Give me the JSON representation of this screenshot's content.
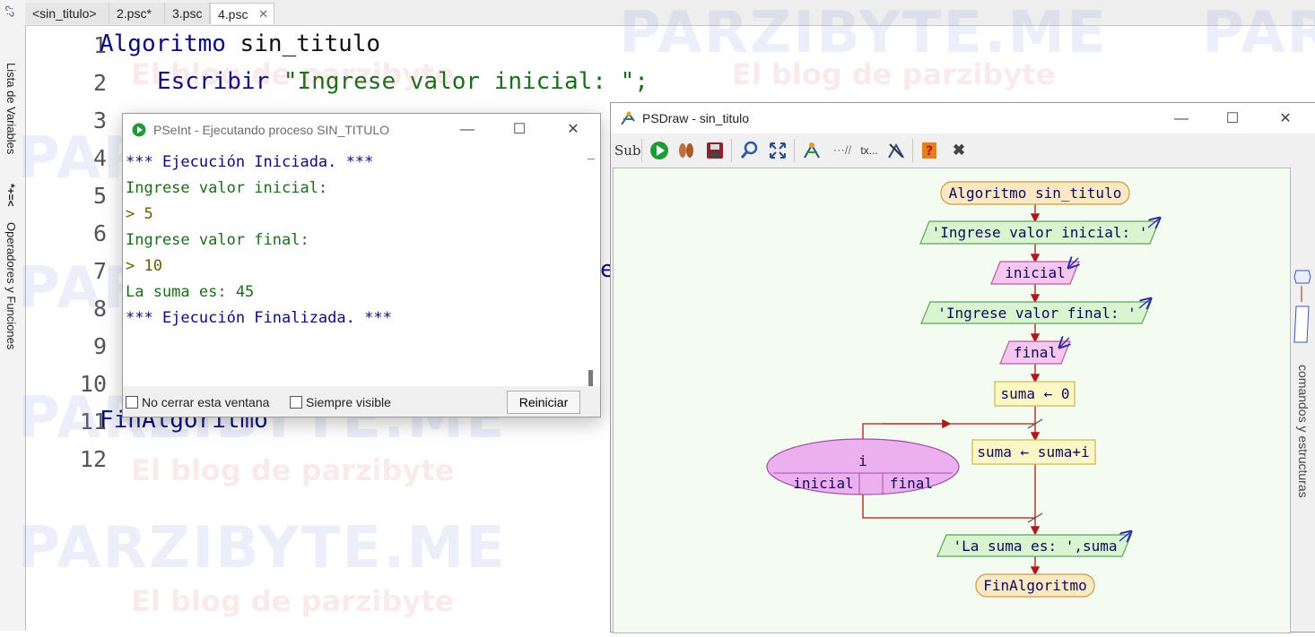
{
  "left_panel": {
    "variables_label": "Lista de Variables",
    "operators_label": "Operadores y Funciones",
    "variables_glyph": "*+=<",
    "top_glyph": "¿?"
  },
  "tabs": [
    {
      "label": "<sin_titulo>",
      "active": false
    },
    {
      "label": "2.psc*",
      "active": false
    },
    {
      "label": "3.psc",
      "active": false
    },
    {
      "label": "4.psc",
      "active": true
    }
  ],
  "tab_close_glyph": "✕",
  "editor": {
    "line_numbers": [
      "1",
      "2",
      "3",
      "4",
      "5",
      "6",
      "7",
      "8",
      "9",
      "10",
      "11",
      "12"
    ],
    "line1_keyword": "Algoritmo",
    "line1_name": "sin_titulo",
    "line2_keyword": "Escribir",
    "line2_string": "\"Ingrese valor inicial: \";",
    "line7_fragment": "e",
    "line11_keyword": "FinAlgoritmo"
  },
  "watermark": {
    "main": "PARZIBYTE.ME",
    "sub": "El blog de parzibyte"
  },
  "console": {
    "title": "PSeInt - Ejecutando proceso SIN_TITULO",
    "lines": [
      {
        "text": "*** Ejecución Iniciada. ***",
        "style": "dark"
      },
      {
        "text": "Ingrese valor inicial:",
        "style": "green"
      },
      {
        "text": "> 5",
        "style": "olive"
      },
      {
        "text": "Ingrese valor final:",
        "style": "green"
      },
      {
        "text": "> 10",
        "style": "olive"
      },
      {
        "text": "La suma es: 45",
        "style": "green"
      },
      {
        "text": "*** Ejecución Finalizada. ***",
        "style": "dark"
      }
    ],
    "no_close_label": "No cerrar esta ventana",
    "always_visible_label": "Siempre visible",
    "restart_label": "Reiniciar",
    "minimize": "—",
    "maximize": "☐",
    "close": "✕"
  },
  "psdraw": {
    "title": "PSDraw - sin_titulo",
    "minimize": "—",
    "maximize": "☐",
    "close": "✕",
    "side_label": "comandos y estructuras",
    "toolbar_sub": "Sub",
    "toolbar_text": "tx...",
    "flow": {
      "start": "Algoritmo sin_titulo",
      "write1": "'Ingrese valor inicial: '",
      "read1": "inicial",
      "write2": "'Ingrese valor final: '",
      "read2": "final",
      "assign1": "suma ← 0",
      "loop_var": "i",
      "loop_from": "inicial",
      "loop_to": "final",
      "assign2": "suma ← suma+i",
      "write3": "'La suma es: ',suma",
      "end": "FinAlgoritmo"
    },
    "colors": {
      "terminal_fill": "#fce9c4",
      "terminal_stroke": "#c89b4a",
      "write_fill": "#d8f5d0",
      "write_stroke": "#5aa55a",
      "read_fill": "#f6c6ee",
      "read_stroke": "#b45ca8",
      "assign_fill": "#fbf7c6",
      "assign_stroke": "#c8b84a",
      "loop_fill": "#edb0ef",
      "loop_stroke": "#a24ea8",
      "arrow": "#b01818"
    }
  }
}
